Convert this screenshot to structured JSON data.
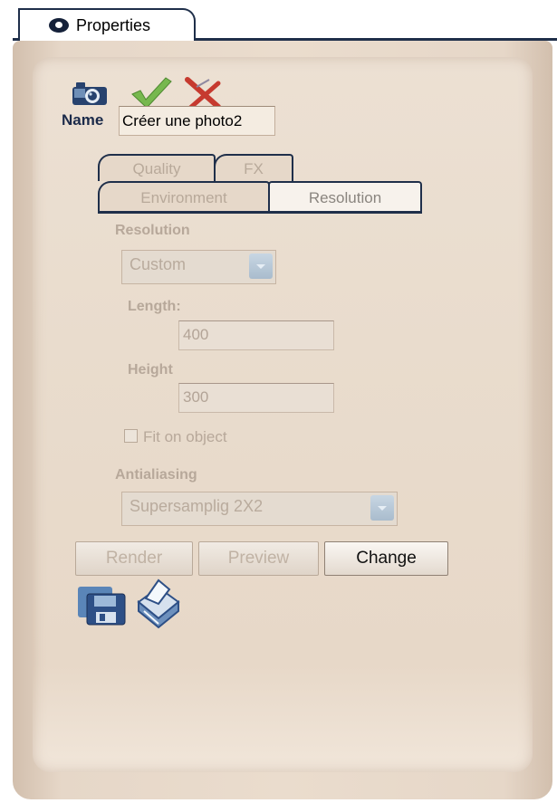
{
  "window": {
    "tab_label": "Properties",
    "tab_icon": "eye-icon"
  },
  "toolbar": {
    "icons": [
      "camera-icon",
      "checkmark-icon",
      "close-icon"
    ]
  },
  "name": {
    "label": "Name",
    "value": "Créer une photo2"
  },
  "subtabs": {
    "row1": [
      "Quality",
      "FX"
    ],
    "row2": [
      "Environment",
      "Resolution"
    ],
    "active": "Resolution"
  },
  "resolution": {
    "section_label": "Resolution",
    "preset": "Custom",
    "length_label": "Length:",
    "length_value": "400",
    "height_label": "Height",
    "height_value": "300",
    "fit_label": "Fit on object",
    "fit_checked": false,
    "antialiasing_label": "Antialiasing",
    "antialiasing_value": "Supersamplig 2X2"
  },
  "buttons": {
    "render": "Render",
    "preview": "Preview",
    "change": "Change"
  },
  "bottom_icons": [
    "save-icon",
    "printer-icon"
  ],
  "colors": {
    "panel_bg": "#e9dccd",
    "tab_border": "#1f2f4a",
    "disabled_text": "#b7a89a",
    "label_text": "#1b2a4a"
  }
}
